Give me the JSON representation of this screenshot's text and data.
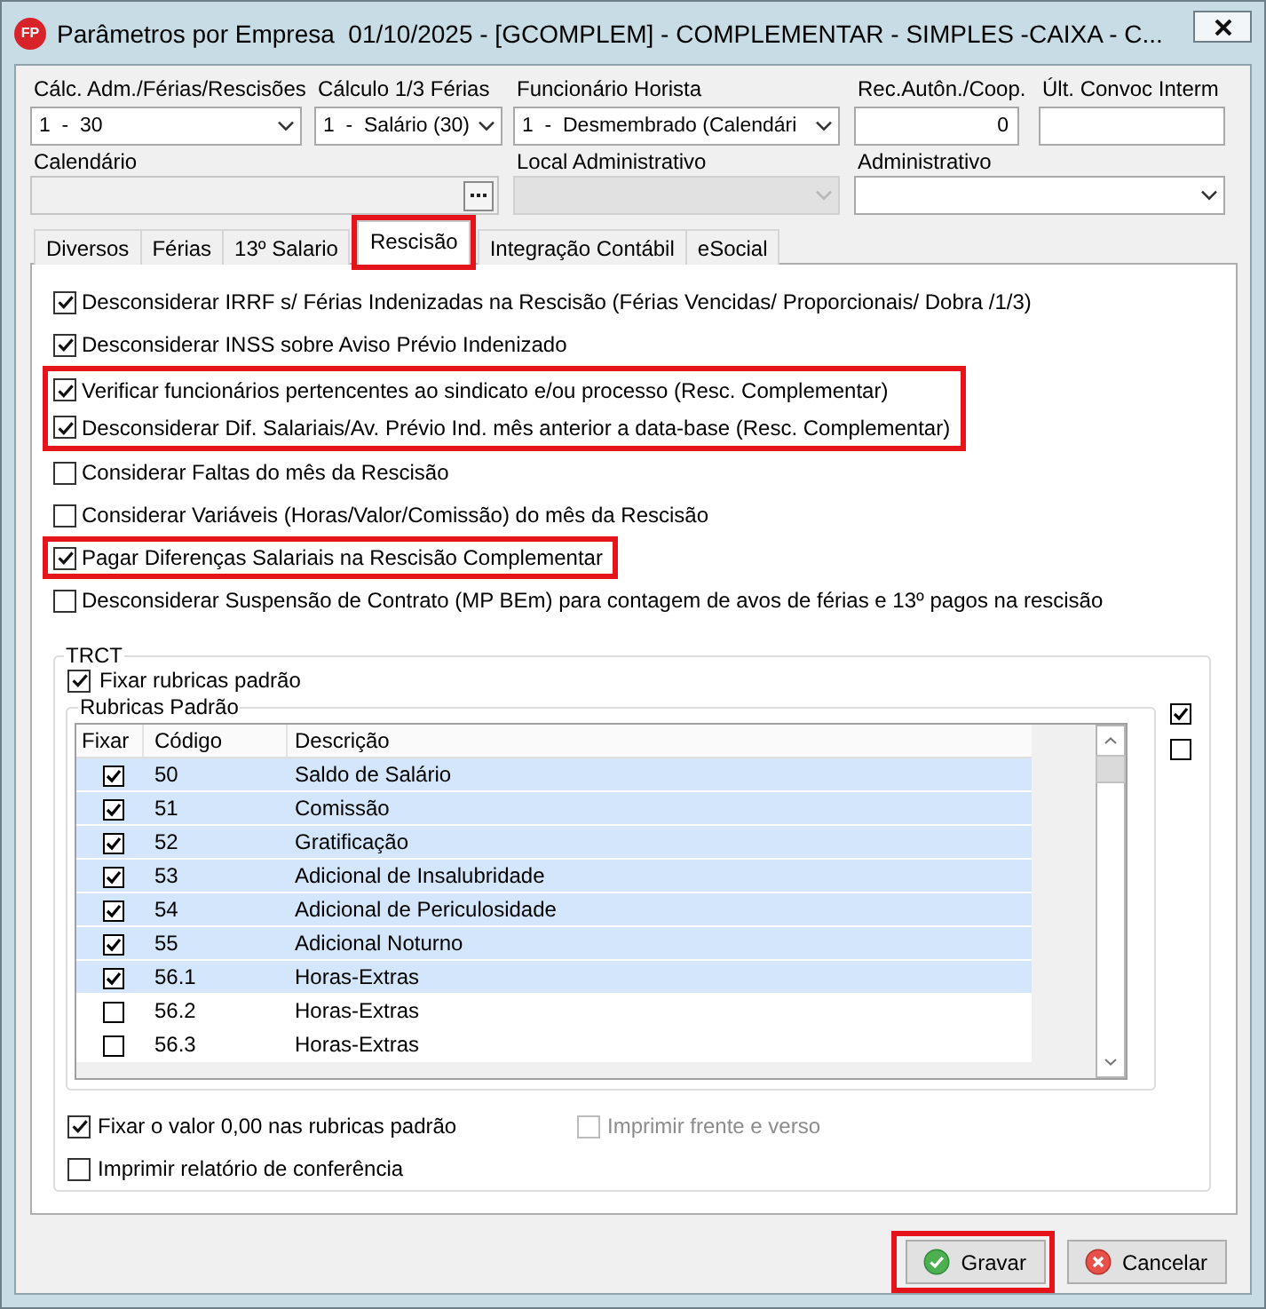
{
  "window": {
    "icon_text": "FP",
    "title": "Parâmetros por Empresa  01/10/2025 - [GCOMPLEM] - COMPLEMENTAR - SIMPLES -CAIXA - C..."
  },
  "field_rows": [
    [
      {
        "label": "Cálc. Adm./Férias/Rescisões",
        "kind": "select",
        "value": "1  -  30",
        "disabled": false
      },
      {
        "label": "Cálculo 1/3 Férias",
        "kind": "select",
        "value": "1  -  Salário (30)",
        "disabled": false
      },
      {
        "label": "Funcionário Horista",
        "kind": "select",
        "value": "1  -  Desmembrado (Calendári",
        "disabled": false
      },
      {
        "label": "Rec.Autôn./Coop.",
        "kind": "number",
        "value": "0",
        "disabled": false
      },
      {
        "label": "Últ. Convoc Interm",
        "kind": "text",
        "disabled": false
      }
    ],
    [
      {
        "label": "Calendário",
        "kind": "lookup",
        "disabled": true
      },
      {
        "label": "Local Administrativo",
        "kind": "select",
        "disabled": true
      },
      {
        "label": "Administrativo",
        "kind": "select",
        "disabled": false
      }
    ]
  ],
  "tabs": [
    {
      "label": "Diversos",
      "selected": false,
      "highlighted": false
    },
    {
      "label": "Férias",
      "selected": false,
      "highlighted": false
    },
    {
      "label": "13º Salario",
      "selected": false,
      "highlighted": false
    },
    {
      "label": "Rescisão",
      "selected": true,
      "highlighted": true
    },
    {
      "label": "Integração Contábil",
      "selected": false,
      "highlighted": false
    },
    {
      "label": "eSocial",
      "selected": false,
      "highlighted": false
    }
  ],
  "options": [
    {
      "label": "Desconsiderar IRRF s/ Férias Indenizadas na Rescisão (Férias Vencidas/ Proporcionais/ Dobra /1/3)",
      "checked": true,
      "highlighted": false
    },
    {
      "label": "Desconsiderar INSS sobre Aviso Prévio Indenizado",
      "checked": true,
      "highlighted": false
    },
    {
      "label": "Verificar funcionários pertencentes ao sindicato e/ou processo (Resc. Complementar)",
      "checked": true,
      "highlighted": true
    },
    {
      "label": "Desconsiderar Dif. Salariais/Av. Prévio Ind. mês anterior a data-base (Resc. Complementar)",
      "checked": true,
      "highlighted": true
    },
    {
      "label": "Considerar Faltas do mês da Rescisão",
      "checked": false,
      "highlighted": false
    },
    {
      "label": "Considerar Variáveis (Horas/Valor/Comissão) do mês da Rescisão",
      "checked": false,
      "highlighted": false
    },
    {
      "label": "Pagar Diferenças Salariais na Rescisão Complementar",
      "checked": true,
      "highlighted": true
    },
    {
      "label": "Desconsiderar Suspensão de Contrato (MP BEm) para contagem de avos de férias e 13º pagos na rescisão",
      "checked": false,
      "highlighted": false
    }
  ],
  "trct": {
    "title": "TRCT",
    "fix_defaults": {
      "label": "Fixar rubricas padrão",
      "checked": true
    },
    "rubricas": {
      "title": "Rubricas Padrão",
      "columns": [
        "Fixar",
        "Código",
        "Descrição"
      ],
      "rows": [
        {
          "checked": true,
          "code": "50",
          "description": "Saldo de Salário"
        },
        {
          "checked": true,
          "code": "51",
          "description": "Comissão"
        },
        {
          "checked": true,
          "code": "52",
          "description": "Gratificação"
        },
        {
          "checked": true,
          "code": "53",
          "description": "Adicional de Insalubridade"
        },
        {
          "checked": true,
          "code": "54",
          "description": "Adicional de Periculosidade"
        },
        {
          "checked": true,
          "code": "55",
          "description": "Adicional Noturno"
        },
        {
          "checked": true,
          "code": "56.1",
          "description": "Horas-Extras"
        },
        {
          "checked": false,
          "code": "56.2",
          "description": "Horas-Extras"
        },
        {
          "checked": false,
          "code": "56.3",
          "description": "Horas-Extras"
        }
      ]
    },
    "side_checkboxes": [
      {
        "checked": true
      },
      {
        "checked": false
      }
    ],
    "bottom_options": [
      {
        "label": "Fixar o valor 0,00 nas rubricas padrão",
        "checked": true,
        "disabled": false
      },
      {
        "label": "Imprimir frente e verso",
        "checked": false,
        "disabled": true
      },
      {
        "label": "Imprimir relatório de conferência",
        "checked": false,
        "disabled": false
      }
    ]
  },
  "buttons": [
    {
      "label": "Gravar",
      "kind": "save",
      "highlighted": true
    },
    {
      "label": "Cancelar",
      "kind": "cancel",
      "highlighted": false
    }
  ]
}
